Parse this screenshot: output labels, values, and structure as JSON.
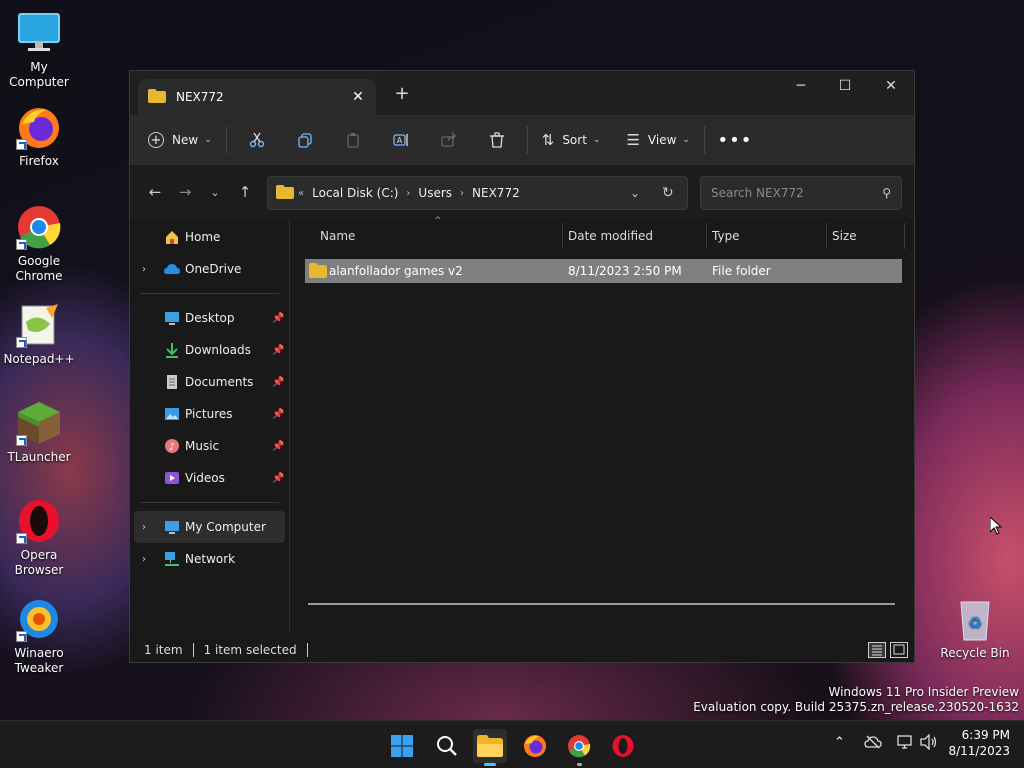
{
  "desktop": {
    "icons": [
      {
        "label": "My Computer"
      },
      {
        "label": "Firefox"
      },
      {
        "label": "Google Chrome"
      },
      {
        "label": "Notepad++"
      },
      {
        "label": "TLauncher"
      },
      {
        "label": "Opera Browser"
      },
      {
        "label": "Winaero Tweaker"
      },
      {
        "label": "Recycle Bin"
      }
    ]
  },
  "explorer": {
    "tab_title": "NEX772",
    "toolbar": {
      "new_label": "New",
      "sort_label": "Sort",
      "view_label": "View"
    },
    "address": {
      "overflow": "«",
      "crumbs": [
        "Local Disk (C:)",
        "Users",
        "NEX772"
      ]
    },
    "search_placeholder": "Search NEX772",
    "sidebar": {
      "home": "Home",
      "onedrive": "OneDrive",
      "pinned": [
        "Desktop",
        "Downloads",
        "Documents",
        "Pictures",
        "Music",
        "Videos"
      ],
      "my_computer": "My Computer",
      "network": "Network"
    },
    "columns": {
      "name": "Name",
      "date": "Date modified",
      "type": "Type",
      "size": "Size"
    },
    "rows": [
      {
        "name": "alanfollador games v2",
        "date": "8/11/2023 2:50 PM",
        "type": "File folder",
        "size": ""
      }
    ],
    "status": {
      "count": "1 item",
      "selected": "1 item selected"
    }
  },
  "watermark": {
    "line1": "Windows 11 Pro Insider Preview",
    "line2": "Evaluation copy. Build 25375.zn_release.230520-1632"
  },
  "clock": {
    "time": "6:39 PM",
    "date": "8/11/2023"
  },
  "colors": {
    "folder": "#e8b830",
    "accent": "#0078d4",
    "selected_row": "#7f7f7f"
  }
}
